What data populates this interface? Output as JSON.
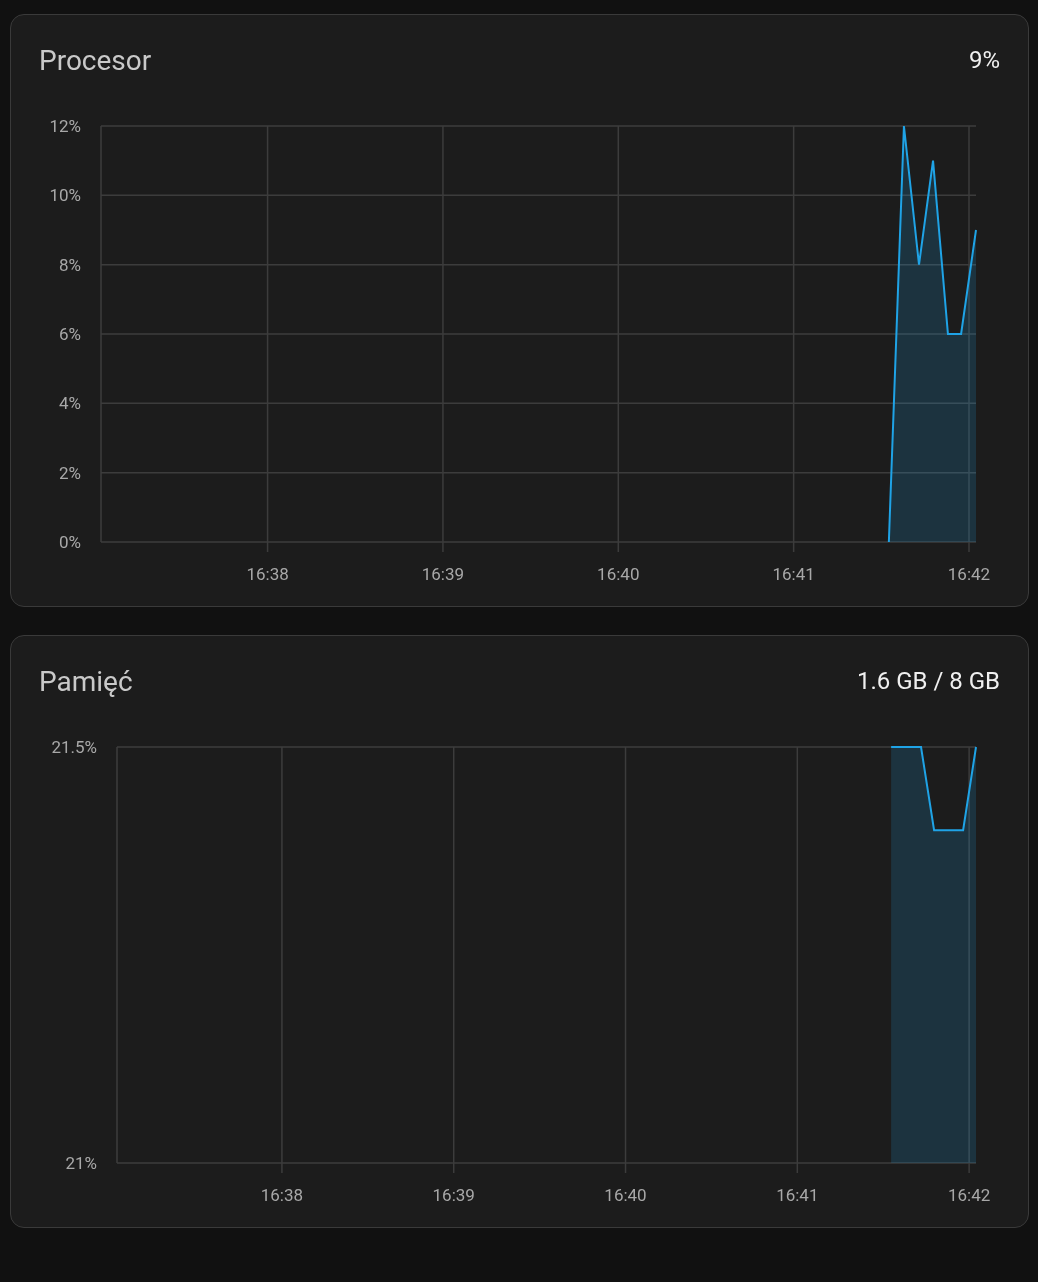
{
  "cards": [
    {
      "title": "Procesor",
      "value": "9%",
      "chart_data": {
        "type": "area",
        "grid": true,
        "x": [
          1001.543,
          1001.629,
          1001.715,
          1001.795,
          1001.88,
          1001.955,
          1002.04
        ],
        "series": [
          {
            "color": "#1fa3e6",
            "values": [
              0,
              12,
              8,
              11,
              6,
              6,
              9
            ]
          }
        ],
        "xlim": [
          997.05,
          1002.04
        ],
        "ylim": [
          0,
          12
        ],
        "xticks": [
          {
            "value": 998,
            "label": "16:38"
          },
          {
            "value": 999,
            "label": "16:39"
          },
          {
            "value": 1000,
            "label": "16:40"
          },
          {
            "value": 1001,
            "label": "16:41"
          },
          {
            "value": 1002,
            "label": "16:42"
          }
        ],
        "yticks": [
          {
            "value": 0,
            "label": "0%"
          },
          {
            "value": 2,
            "label": "2%"
          },
          {
            "value": 4,
            "label": "4%"
          },
          {
            "value": 6,
            "label": "6%"
          },
          {
            "value": 8,
            "label": "8%"
          },
          {
            "value": 10,
            "label": "10%"
          },
          {
            "value": 12,
            "label": "12%"
          }
        ]
      }
    },
    {
      "title": "Pamięć",
      "value": "1.6 GB / 8 GB",
      "chart_data": {
        "type": "area",
        "grid": true,
        "x": [
          1001.546,
          1001.72,
          1001.796,
          1001.965,
          1002.04
        ],
        "series": [
          {
            "color": "#1fa3e6",
            "values": [
              21.5,
              21.5,
              21.4,
              21.4,
              21.5
            ]
          }
        ],
        "xlim": [
          997.04,
          1002.04
        ],
        "ylim": [
          21,
          21.5
        ],
        "xticks": [
          {
            "value": 998,
            "label": "16:38"
          },
          {
            "value": 999,
            "label": "16:39"
          },
          {
            "value": 1000,
            "label": "16:40"
          },
          {
            "value": 1001,
            "label": "16:41"
          },
          {
            "value": 1002,
            "label": "16:42"
          }
        ],
        "yticks": [
          {
            "value": 21,
            "label": "21%"
          },
          {
            "value": 21.5,
            "label": "21.5%"
          }
        ]
      }
    }
  ]
}
